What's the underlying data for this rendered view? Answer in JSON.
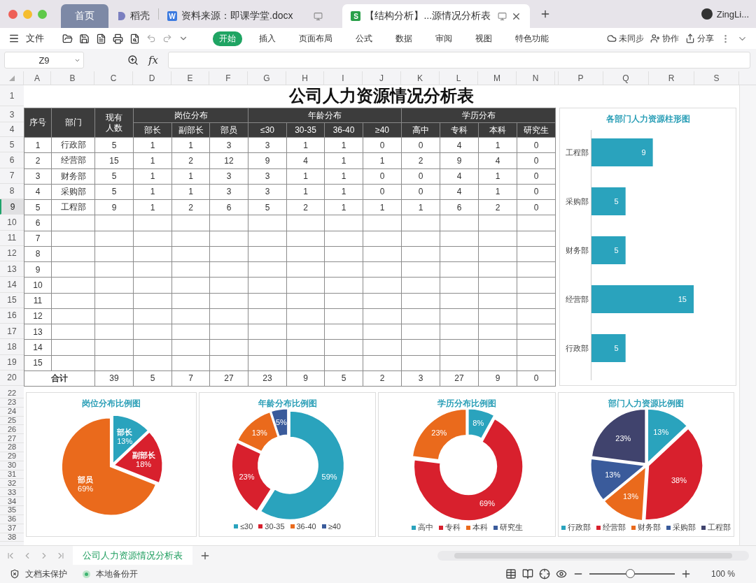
{
  "tabs": [
    {
      "label": "首页",
      "kind": "home",
      "selected": false
    },
    {
      "label": "稻壳",
      "kind": "docer",
      "selected": false
    },
    {
      "label": "资料来源：即课学堂.docx",
      "kind": "doc",
      "badge": "W",
      "selected": false
    },
    {
      "label": "【结构分析】...源情况分析表",
      "kind": "sheet",
      "badge": "S",
      "selected": true
    }
  ],
  "user": {
    "name": "ZingLi..."
  },
  "menu": {
    "file": "文件",
    "ribbon_tabs": [
      {
        "label": "开始",
        "selected": true
      },
      {
        "label": "插入",
        "selected": false
      },
      {
        "label": "页面布局",
        "selected": false
      },
      {
        "label": "公式",
        "selected": false
      },
      {
        "label": "数据",
        "selected": false
      },
      {
        "label": "审阅",
        "selected": false
      },
      {
        "label": "视图",
        "selected": false
      },
      {
        "label": "特色功能",
        "selected": false
      }
    ],
    "actions": [
      "未同步",
      "协作",
      "分享"
    ]
  },
  "formula_bar": {
    "name_box": "Z9",
    "function_label": "fx"
  },
  "column_headers": [
    "A",
    "B",
    "C",
    "D",
    "E",
    "F",
    "G",
    "H",
    "I",
    "J",
    "K",
    "L",
    "M",
    "N",
    "P",
    "Q",
    "R",
    "S"
  ],
  "row_numbers": [
    {
      "label": "1",
      "kind": "title",
      "selected": false
    },
    {
      "label": "3",
      "kind": "header",
      "selected": false
    },
    {
      "label": "4",
      "kind": "header",
      "selected": false
    },
    {
      "label": "5",
      "kind": "data",
      "selected": false
    },
    {
      "label": "6",
      "kind": "data",
      "selected": false
    },
    {
      "label": "7",
      "kind": "data",
      "selected": false
    },
    {
      "label": "8",
      "kind": "data",
      "selected": false
    },
    {
      "label": "9",
      "kind": "data",
      "selected": true
    },
    {
      "label": "10",
      "kind": "data",
      "selected": false
    },
    {
      "label": "11",
      "kind": "data",
      "selected": false
    },
    {
      "label": "12",
      "kind": "data",
      "selected": false
    },
    {
      "label": "13",
      "kind": "data",
      "selected": false
    },
    {
      "label": "14",
      "kind": "data",
      "selected": false
    },
    {
      "label": "15",
      "kind": "data",
      "selected": false
    },
    {
      "label": "16",
      "kind": "data",
      "selected": false
    },
    {
      "label": "17",
      "kind": "data",
      "selected": false
    },
    {
      "label": "18",
      "kind": "data",
      "selected": false
    },
    {
      "label": "19",
      "kind": "data",
      "selected": false
    },
    {
      "label": "20",
      "kind": "data",
      "selected": false
    },
    {
      "label": "22",
      "kind": "small",
      "selected": false
    },
    {
      "label": "23",
      "kind": "small",
      "selected": false
    },
    {
      "label": "24",
      "kind": "small",
      "selected": false
    },
    {
      "label": "25",
      "kind": "small",
      "selected": false
    },
    {
      "label": "26",
      "kind": "small",
      "selected": false
    },
    {
      "label": "27",
      "kind": "small",
      "selected": false
    },
    {
      "label": "28",
      "kind": "small",
      "selected": false
    },
    {
      "label": "29",
      "kind": "small",
      "selected": false
    },
    {
      "label": "30",
      "kind": "small",
      "selected": false
    },
    {
      "label": "31",
      "kind": "small",
      "selected": false
    },
    {
      "label": "32",
      "kind": "small",
      "selected": false
    },
    {
      "label": "33",
      "kind": "small",
      "selected": false
    },
    {
      "label": "34",
      "kind": "small",
      "selected": false
    },
    {
      "label": "35",
      "kind": "small",
      "selected": false
    },
    {
      "label": "36",
      "kind": "small",
      "selected": false
    },
    {
      "label": "37",
      "kind": "small",
      "selected": false
    },
    {
      "label": "38",
      "kind": "small",
      "selected": false
    }
  ],
  "sheet": {
    "title": "公司人力资源情况分析表",
    "fixed_headers": [
      "序号",
      "部门",
      "现有人数"
    ],
    "header_groups": [
      {
        "label": "岗位分布",
        "columns": [
          "部长",
          "副部长",
          "部员"
        ]
      },
      {
        "label": "年龄分布",
        "columns": [
          "≤30",
          "30-35",
          "36-40",
          "≥40"
        ]
      },
      {
        "label": "学历分布",
        "columns": [
          "高中",
          "专科",
          "本科",
          "研究生"
        ]
      }
    ],
    "rows": [
      [
        "1",
        "行政部",
        "5",
        "1",
        "1",
        "3",
        "3",
        "1",
        "1",
        "0",
        "0",
        "4",
        "1",
        "0"
      ],
      [
        "2",
        "经营部",
        "15",
        "1",
        "2",
        "12",
        "9",
        "4",
        "1",
        "1",
        "2",
        "9",
        "4",
        "0"
      ],
      [
        "3",
        "财务部",
        "5",
        "1",
        "1",
        "3",
        "3",
        "1",
        "1",
        "0",
        "0",
        "4",
        "1",
        "0"
      ],
      [
        "4",
        "采购部",
        "5",
        "1",
        "1",
        "3",
        "3",
        "1",
        "1",
        "0",
        "0",
        "4",
        "1",
        "0"
      ],
      [
        "5",
        "工程部",
        "9",
        "1",
        "2",
        "6",
        "5",
        "2",
        "1",
        "1",
        "1",
        "6",
        "2",
        "0"
      ],
      [
        "6"
      ],
      [
        "7"
      ],
      [
        "8"
      ],
      [
        "9"
      ],
      [
        "10"
      ],
      [
        "11"
      ],
      [
        "12"
      ],
      [
        "13"
      ],
      [
        "14"
      ],
      [
        "15"
      ]
    ],
    "total": {
      "label": "合计",
      "values": [
        "39",
        "5",
        "7",
        "27",
        "23",
        "9",
        "5",
        "2",
        "3",
        "27",
        "9",
        "0"
      ]
    }
  },
  "bar_chart": {
    "chart_data": {
      "type": "bar",
      "orientation": "horizontal",
      "title": "各部门人力资源柱形图",
      "categories": [
        "工程部",
        "采购部",
        "财务部",
        "经营部",
        "行政部"
      ],
      "values": [
        9,
        5,
        5,
        15,
        5
      ],
      "data_labels": true
    }
  },
  "pie_charts": [
    {
      "legend": false,
      "chart_data": {
        "type": "pie",
        "title": "岗位分布比例图",
        "categories": [
          "部长",
          "副部长",
          "部员"
        ],
        "values": [
          13,
          18,
          69
        ],
        "value_labels": [
          "13%",
          "18%",
          "69%"
        ]
      }
    },
    {
      "legend": true,
      "chart_data": {
        "type": "donut",
        "title": "年龄分布比例图",
        "categories": [
          "≤30",
          "30-35",
          "36-40",
          "≥40"
        ],
        "values": [
          59,
          23,
          13,
          5
        ],
        "value_labels": [
          "59%",
          "23%",
          "13%",
          "5%"
        ]
      }
    },
    {
      "legend": true,
      "chart_data": {
        "type": "donut",
        "title": "学历分布比例图",
        "categories": [
          "高中",
          "专科",
          "本科",
          "研究生"
        ],
        "values": [
          8,
          69,
          23,
          0
        ],
        "value_labels": [
          "8%",
          "69%",
          "23%",
          null
        ]
      }
    },
    {
      "legend": true,
      "chart_data": {
        "type": "pie",
        "title": "部门人力资源比例图",
        "categories": [
          "行政部",
          "经营部",
          "财务部",
          "采购部",
          "工程部"
        ],
        "values": [
          13,
          38,
          13,
          13,
          23
        ],
        "value_labels": [
          "13%",
          "38%",
          "13%",
          "13%",
          "23%"
        ]
      }
    }
  ],
  "sheet_tabs": [
    {
      "label": "公司人力资源情况分析表",
      "selected": true
    }
  ],
  "status_bar": {
    "protection": "文档未保护",
    "backup": "本地备份开",
    "zoom": {
      "level": 0.48,
      "reading": "100 %"
    }
  }
}
